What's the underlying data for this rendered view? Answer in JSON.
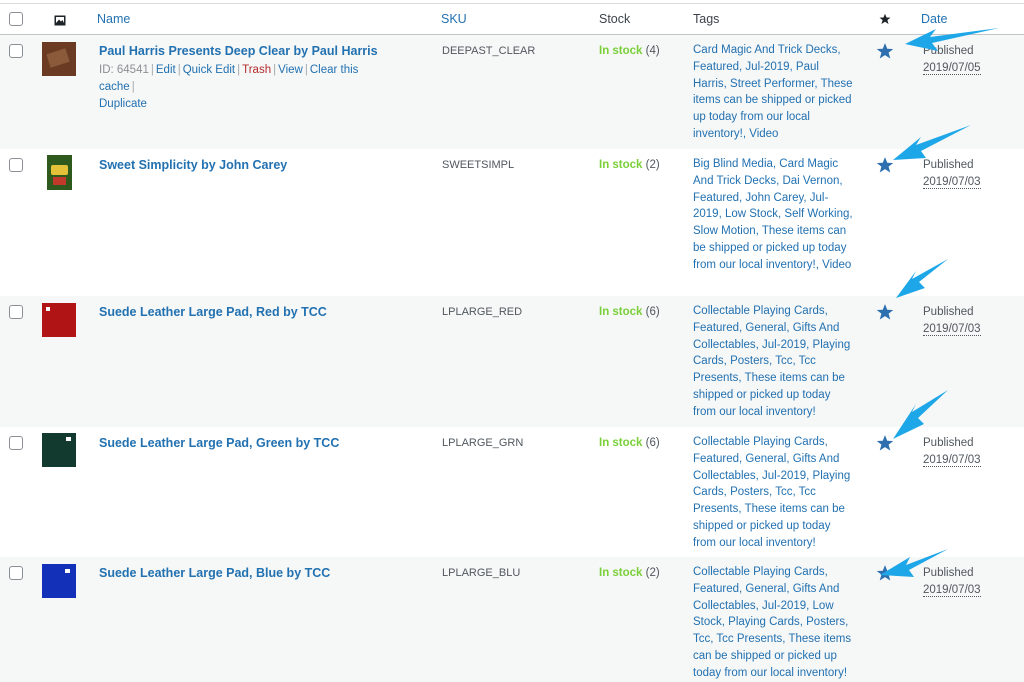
{
  "header": {
    "name": "Name",
    "sku": "SKU",
    "stock": "Stock",
    "tags": "Tags",
    "date": "Date"
  },
  "row_actions": {
    "id_prefix": "ID: ",
    "edit": "Edit",
    "quick_edit": "Quick Edit",
    "trash": "Trash",
    "view": "View",
    "clear_cache": "Clear this cache",
    "duplicate": "Duplicate"
  },
  "rows": [
    {
      "name": "Paul Harris Presents Deep Clear by Paul Harris",
      "id": "64541",
      "sku": "DEEPAST_CLEAR",
      "stock_status": "In stock",
      "stock_count": "(4)",
      "tags": "Card Magic And Trick Decks, Featured, Jul-2019, Paul Harris, Street Performer, These items can be shipped or picked up today from our local inventory!, Video",
      "status": "Published",
      "date": "2019/07/05",
      "thumb_color": "#6b3a22"
    },
    {
      "name": "Sweet Simplicity by John Carey",
      "sku": "SWEETSIMPL",
      "stock_status": "In stock",
      "stock_count": "(2)",
      "tags": "Big Blind Media, Card Magic And Trick Decks, Dai Vernon, Featured, John Carey, Jul-2019, Low Stock, Self Working, Slow Motion, These items can be shipped or picked up today from our local inventory!, Video",
      "status": "Published",
      "date": "2019/07/03",
      "thumb_color": "#2f5a1e"
    },
    {
      "name": "Suede Leather Large Pad, Red by TCC",
      "sku": "LPLARGE_RED",
      "stock_status": "In stock",
      "stock_count": "(6)",
      "tags": "Collectable Playing Cards, Featured, General, Gifts And Collectables, Jul-2019, Playing Cards, Posters, Tcc, Tcc Presents, These items can be shipped or picked up today from our local inventory!",
      "status": "Published",
      "date": "2019/07/03",
      "thumb_color": "#b01414"
    },
    {
      "name": "Suede Leather Large Pad, Green by TCC",
      "sku": "LPLARGE_GRN",
      "stock_status": "In stock",
      "stock_count": "(6)",
      "tags": "Collectable Playing Cards, Featured, General, Gifts And Collectables, Jul-2019, Playing Cards, Posters, Tcc, Tcc Presents, These items can be shipped or picked up today from our local inventory!",
      "status": "Published",
      "date": "2019/07/03",
      "thumb_color": "#123a2e"
    },
    {
      "name": "Suede Leather Large Pad, Blue by TCC",
      "sku": "LPLARGE_BLU",
      "stock_status": "In stock",
      "stock_count": "(2)",
      "tags": "Collectable Playing Cards, Featured, General, Gifts And Collectables, Jul-2019, Low Stock, Playing Cards, Posters, Tcc, Tcc Presents, These items can be shipped or picked up today from our local inventory!",
      "status": "Published",
      "date": "2019/07/03",
      "thumb_color": "#1330b8"
    }
  ],
  "colors": {
    "link": "#2271b1",
    "in_stock": "#7ad03a",
    "star": "#2e6fb0",
    "arrow": "#1ea7e8",
    "trash": "#b32d2e"
  },
  "icons": {
    "header_image": "image-icon",
    "header_featured": "star-icon",
    "featured": "star-icon",
    "annotation": "arrow-annotation"
  }
}
